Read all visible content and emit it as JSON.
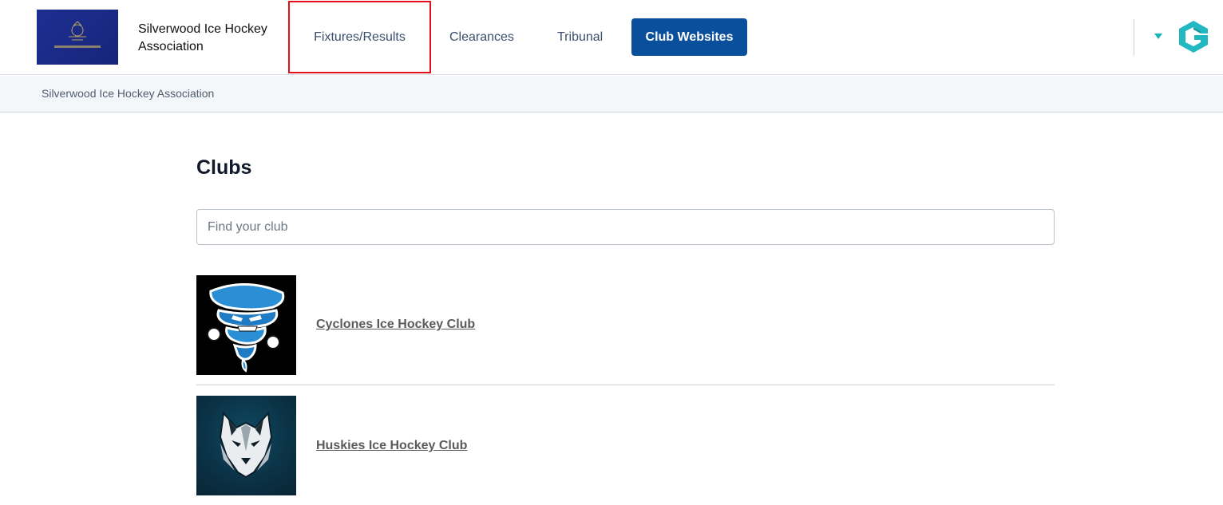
{
  "header": {
    "org_name": "Silverwood Ice Hockey Association",
    "nav": {
      "fixtures": "Fixtures/Results",
      "clearances": "Clearances",
      "tribunal": "Tribunal",
      "club_websites": "Club Websites"
    }
  },
  "breadcrumb": {
    "current": "Silverwood Ice Hockey Association"
  },
  "main": {
    "title": "Clubs",
    "search": {
      "placeholder": "Find your club",
      "value": ""
    },
    "clubs": [
      {
        "name": "Cyclones Ice Hockey Club",
        "logo_icon": "tornado-mascot-icon"
      },
      {
        "name": "Huskies Ice Hockey Club",
        "logo_icon": "wolf-mascot-icon"
      }
    ]
  },
  "colors": {
    "accent": "#0a4f9c",
    "highlight_border": "#e3101a",
    "brand_teal": "#1ab3bd"
  }
}
